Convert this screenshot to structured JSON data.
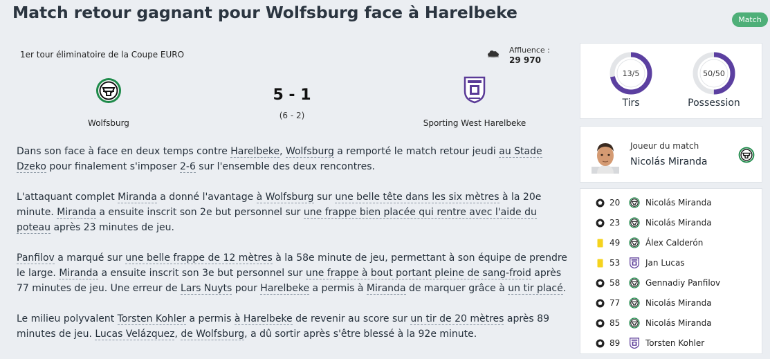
{
  "header": {
    "title": "Match retour gagnant pour Wolfsburg face à Harelbeke",
    "badge": "Match"
  },
  "match": {
    "competition": "1er tour éliminatoire de la Coupe EURO",
    "weather_icon": "cloud-icon",
    "attendance_label": "Affluence :",
    "attendance_value": "29 970",
    "home_team": "Wolfsburg",
    "away_team": "Sporting West Harelbeke",
    "score": "5 - 1",
    "aggregate": "(6 - 2)",
    "colors": {
      "home": "#1e8a4a",
      "away": "#5a3a97"
    }
  },
  "stats": {
    "shots_value": "13/5",
    "shots_label": "Tirs",
    "shots_fraction": 0.72,
    "possession_value": "50/50",
    "possession_label": "Possession",
    "possession_fraction": 0.5,
    "ring_color": "#5b3fa0"
  },
  "motm": {
    "label": "Joueur du match",
    "name": "Nicolás Miranda"
  },
  "events": [
    {
      "type": "goal",
      "minute": "20",
      "team": "home",
      "player": "Nicolás Miranda"
    },
    {
      "type": "goal",
      "minute": "23",
      "team": "home",
      "player": "Nicolás Miranda"
    },
    {
      "type": "yellow-card",
      "minute": "49",
      "team": "home",
      "player": "Álex Calderón"
    },
    {
      "type": "yellow-card",
      "minute": "53",
      "team": "away",
      "player": "Jan Lucas"
    },
    {
      "type": "goal",
      "minute": "58",
      "team": "home",
      "player": "Gennadiy Panfilov"
    },
    {
      "type": "goal",
      "minute": "77",
      "team": "home",
      "player": "Nicolás Miranda"
    },
    {
      "type": "goal",
      "minute": "85",
      "team": "home",
      "player": "Nicolás Miranda"
    },
    {
      "type": "goal",
      "minute": "89",
      "team": "away",
      "player": "Torsten Kohler"
    }
  ],
  "report": {
    "p1": [
      {
        "t": "Dans son face à face en deux temps contre "
      },
      {
        "t": "Harelbeke",
        "link": true
      },
      {
        "t": ", "
      },
      {
        "t": "Wolfsburg",
        "link": true
      },
      {
        "t": " a remporté le match retour jeudi "
      },
      {
        "t": "au Stade Dzeko",
        "link": true
      },
      {
        "t": " pour finalement s'imposer "
      },
      {
        "t": "2-6",
        "link": true
      },
      {
        "t": " sur l'ensemble des deux rencontres."
      }
    ],
    "p2": [
      {
        "t": "L'attaquant complet "
      },
      {
        "t": "Miranda",
        "link": true
      },
      {
        "t": " a donné l'avantage "
      },
      {
        "t": "à Wolfsburg",
        "link": true
      },
      {
        "t": " sur "
      },
      {
        "t": "une belle tête dans les six mètres",
        "link": true
      },
      {
        "t": " à la 20e minute. "
      },
      {
        "t": "Miranda",
        "link": true
      },
      {
        "t": " a ensuite inscrit son 2e but personnel sur "
      },
      {
        "t": "une frappe bien placée qui rentre avec l'aide du poteau",
        "link": true
      },
      {
        "t": " après 23 minutes de jeu."
      }
    ],
    "p3": [
      {
        "t": "Panfilov",
        "link": true
      },
      {
        "t": " a marqué sur "
      },
      {
        "t": "une belle frappe de 12 mètres",
        "link": true
      },
      {
        "t": " à la 58e minute de jeu, permettant à son équipe de prendre le large. "
      },
      {
        "t": "Miranda",
        "link": true
      },
      {
        "t": " a ensuite inscrit son 3e but personnel sur "
      },
      {
        "t": "une frappe à bout portant pleine de sang-froid",
        "link": true
      },
      {
        "t": " après 77 minutes de jeu. Une erreur de "
      },
      {
        "t": "Lars Nuyts",
        "link": true
      },
      {
        "t": " pour "
      },
      {
        "t": "Harelbeke",
        "link": true
      },
      {
        "t": " a permis à "
      },
      {
        "t": "Miranda",
        "link": true
      },
      {
        "t": " de marquer grâce à "
      },
      {
        "t": "un tir placé",
        "link": true
      },
      {
        "t": "."
      }
    ],
    "p4": [
      {
        "t": "Le milieu polyvalent "
      },
      {
        "t": "Torsten Kohler",
        "link": true
      },
      {
        "t": " a permis "
      },
      {
        "t": "à Harelbeke",
        "link": true
      },
      {
        "t": " de revenir au score sur "
      },
      {
        "t": "un tir de 20 mètres",
        "link": true
      },
      {
        "t": " après 89 minutes de jeu. "
      },
      {
        "t": "Lucas Velázquez",
        "link": true
      },
      {
        "t": ", "
      },
      {
        "t": "de Wolfsburg",
        "link": true
      },
      {
        "t": ", a dû sortir après s'être blessé à la 92e minute."
      }
    ]
  }
}
